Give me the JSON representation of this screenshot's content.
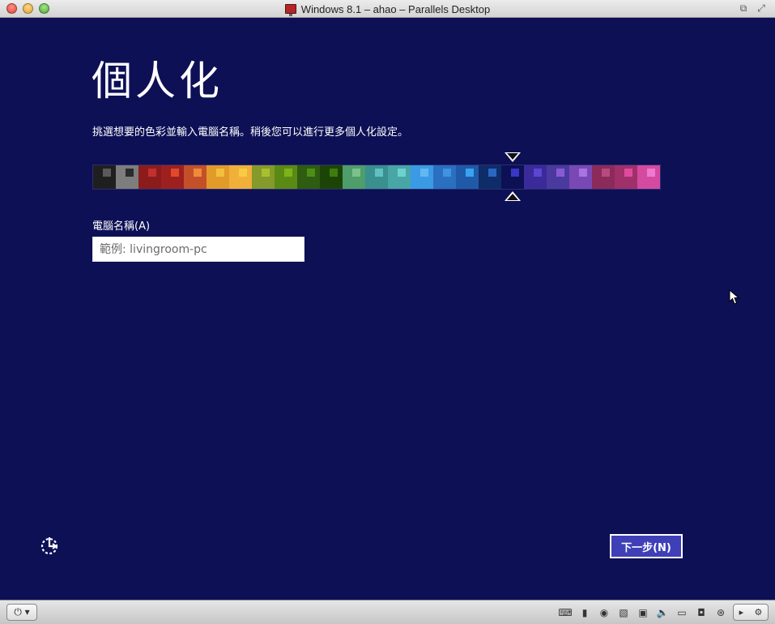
{
  "window": {
    "title": "Windows 8.1 – ahao – Parallels Desktop"
  },
  "setup": {
    "heading": "個人化",
    "subtext": "挑選想要的色彩並輸入電腦名稱。稍後您可以進行更多個人化設定。",
    "pc_name_label": "電腦名稱(A)",
    "pc_name_placeholder": "範例: livingroom-pc",
    "pc_name_value": "",
    "next_button": "下一步(N)",
    "selected_swatch_index": 18,
    "palette": [
      {
        "bg": "#1f1f1f",
        "chip": "#5a5a5a"
      },
      {
        "bg": "#7d7d7d",
        "chip": "#2b2b2b"
      },
      {
        "bg": "#8c1c1c",
        "chip": "#c2302e"
      },
      {
        "bg": "#9e1f1f",
        "chip": "#e04a2a"
      },
      {
        "bg": "#c4502a",
        "chip": "#ee8a3c"
      },
      {
        "bg": "#e29a2a",
        "chip": "#f3bf3e"
      },
      {
        "bg": "#f0b03a",
        "chip": "#f8cb45"
      },
      {
        "bg": "#849a2a",
        "chip": "#a9c02e"
      },
      {
        "bg": "#5a8a14",
        "chip": "#7db21a"
      },
      {
        "bg": "#2e5c10",
        "chip": "#4e8e16"
      },
      {
        "bg": "#1c4406",
        "chip": "#3f7c0e"
      },
      {
        "bg": "#4e9d6a",
        "chip": "#7bc18c"
      },
      {
        "bg": "#3a8f8f",
        "chip": "#5fc2c0"
      },
      {
        "bg": "#48a6a6",
        "chip": "#6dd1cf"
      },
      {
        "bg": "#3a9ae4",
        "chip": "#63b8f2"
      },
      {
        "bg": "#2a6fc0",
        "chip": "#3f93e0"
      },
      {
        "bg": "#1f5aa8",
        "chip": "#3aa2f0"
      },
      {
        "bg": "#0e2c68",
        "chip": "#2a66c4"
      },
      {
        "bg": "#0d1055",
        "chip": "#3a36c6"
      },
      {
        "bg": "#3a2a9a",
        "chip": "#5a46d0"
      },
      {
        "bg": "#4a3a9e",
        "chip": "#8a5ad4"
      },
      {
        "bg": "#7a48b4",
        "chip": "#a874e2"
      },
      {
        "bg": "#8c2a5a",
        "chip": "#b84a7e"
      },
      {
        "bg": "#a0306a",
        "chip": "#e04a9c"
      },
      {
        "bg": "#d44aa0",
        "chip": "#ee7ad0"
      }
    ]
  },
  "statusbar": {
    "power_label": "⏻ ▾"
  },
  "colors": {
    "screen_bg": "#0d1055",
    "accent_button": "#3f3fb8"
  }
}
